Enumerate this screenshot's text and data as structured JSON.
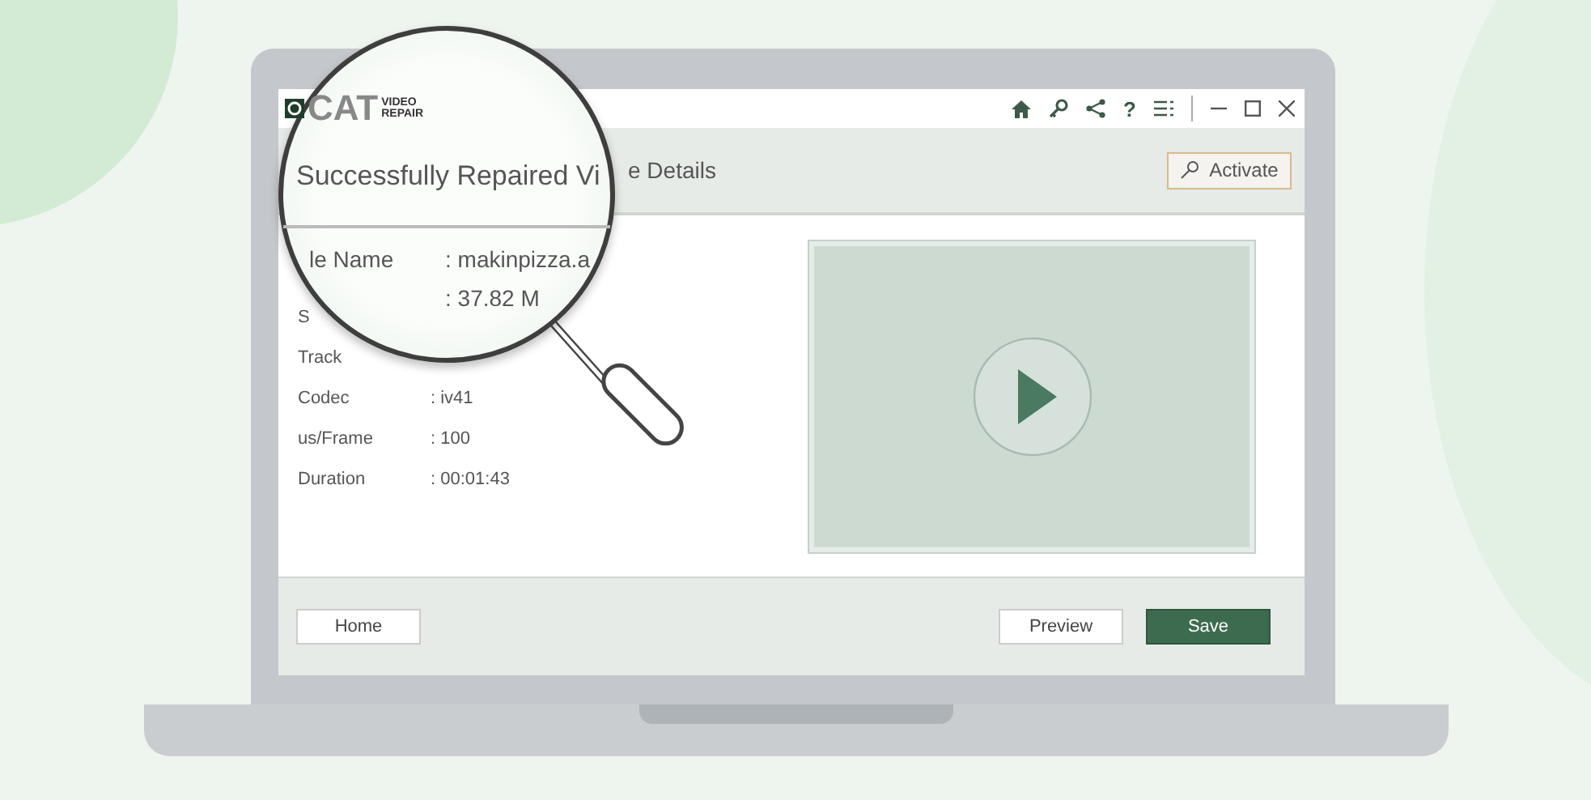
{
  "app": {
    "logo": {
      "main": "CAT",
      "top": "VIDEO",
      "bottom": "REPAIR"
    },
    "help_glyph": "?"
  },
  "header": {
    "title": "e Details",
    "activate_button": "Activate"
  },
  "details": [
    {
      "label": "S"
    },
    {
      "label": "Track"
    },
    {
      "label": "Codec",
      "value": ": iv41"
    },
    {
      "label": "us/Frame",
      "value": ": 100"
    },
    {
      "label": "Duration",
      "value": ": 00:01:43"
    }
  ],
  "magnifier": {
    "title": "Successfully Repaired Vi",
    "rows": [
      {
        "label": "le Name",
        "value": ": makinpizza.a"
      },
      {
        "value": ": 37.82 M"
      }
    ]
  },
  "footer": {
    "left_buttons": [
      {
        "label": "Home",
        "kind": "plain"
      }
    ],
    "right_buttons": [
      {
        "label": "Preview",
        "kind": "plain"
      },
      {
        "label": "Save",
        "kind": "primary"
      }
    ]
  }
}
